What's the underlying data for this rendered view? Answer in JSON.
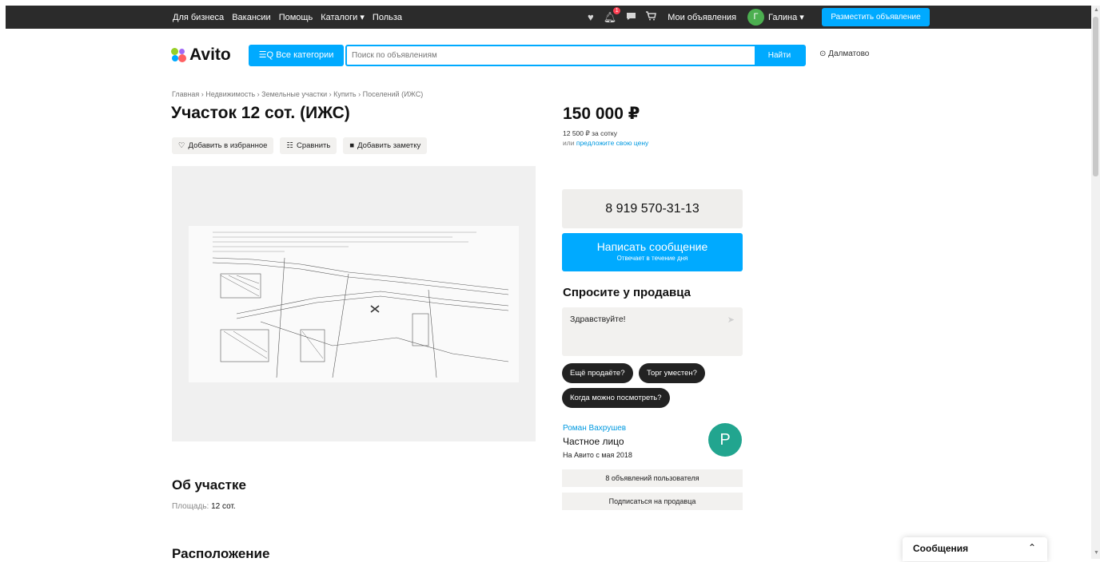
{
  "topbar": {
    "nav": [
      "Для бизнеса",
      "Вакансии",
      "Помощь",
      "Каталоги ▾",
      "Польза"
    ],
    "notifications_badge": "1",
    "my_ads": "Мои объявления",
    "user_initial": "Г",
    "user_name": "Галина ▾",
    "post_ad": "Разместить объявление"
  },
  "header": {
    "logo": "Avito",
    "categories_button": "☰Q Все категории",
    "search_placeholder": "Поиск по объявлениям",
    "search_button": "Найти",
    "location": "Далматово"
  },
  "breadcrumb": "Главная › Недвижимость › Земельные участки › Купить › Поселений (ИЖС)",
  "listing": {
    "title": "Участок 12 сот. (ИЖС)",
    "actions": {
      "favorite": "Добавить в избранное",
      "compare": "Сравнить",
      "note": "Добавить заметку"
    },
    "price": "150 000 ₽",
    "price_per_unit": "12 500 ₽ за сотку",
    "offer_prefix": "или",
    "offer_link": "предложите свою цену"
  },
  "contact": {
    "phone": "8 919 570-31-13",
    "message_button": "Написать сообщение",
    "message_sub": "Отвечает в течение дня"
  },
  "ask": {
    "title": "Спросите у продавца",
    "text": "Здравствуйте!",
    "chips": [
      "Ещё продаёте?",
      "Торг уместен?",
      "Когда можно посмотреть?"
    ]
  },
  "seller": {
    "name": "Роман Вахрушев",
    "type": "Частное лицо",
    "since": "На Авито с мая 2018",
    "initial": "Р",
    "listings_button": "8 объявлений пользователя",
    "subscribe_button": "Подписаться на продавца"
  },
  "about": {
    "title": "Об участке",
    "area_label": "Площадь:",
    "area_value": "12 сот."
  },
  "location_section": {
    "title": "Расположение"
  },
  "messages_widget": {
    "title": "Сообщения"
  },
  "colors": {
    "accent": "#00aaff",
    "topbar": "#2b2b2b",
    "seller_avatar": "#22a58f",
    "user_avatar": "#4caf50"
  }
}
